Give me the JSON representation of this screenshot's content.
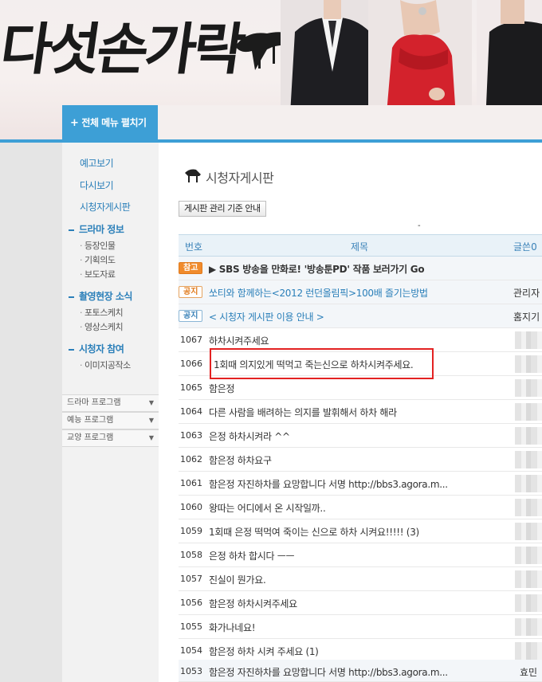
{
  "header": {
    "logo_text": "다섯손가락",
    "menu_button_plus": "+",
    "menu_button_label": "전체 메뉴 펼치기"
  },
  "sidebar": {
    "links": [
      "예고보기",
      "다시보기",
      "시청자게시판"
    ],
    "sections": [
      {
        "title": "드라마 정보",
        "items": [
          "등장인물",
          "기획의도",
          "보도자료"
        ]
      },
      {
        "title": "촬영현장 소식",
        "items": [
          "포토스케치",
          "영상스케치"
        ]
      },
      {
        "title": "시청자 참여",
        "items": [
          "이미지공작소"
        ]
      }
    ],
    "dropdowns": [
      "드라마 프로그램",
      "예능 프로그램",
      "교양 프로그램"
    ]
  },
  "board": {
    "title": "시청자게시판",
    "guide_button": "게시판 관리 기준 안내",
    "tick": "-",
    "columns": {
      "num": "번호",
      "title": "제목",
      "author": "글쓴0"
    },
    "pinned": [
      {
        "badge": "참고",
        "title": "▶ SBS 방송을 만화로! '방송툰PD' 작품 보러가기 Go",
        "author": ""
      },
      {
        "badge": "공지",
        "title": "쏘티와 함께하는<2012 런던올림픽>100배 즐기는방법",
        "author": "관리자"
      },
      {
        "badge": "공지",
        "title": "< 시청자 게시판 이용 안내 >",
        "author": "홈지기"
      }
    ],
    "posts": [
      {
        "num": "1067",
        "title": "하차시켜주세요"
      },
      {
        "num": "1066",
        "title": "1회때 의지있게 떡먹고 죽는신으로 하차시켜주세요."
      },
      {
        "num": "1065",
        "title": "함은정"
      },
      {
        "num": "1064",
        "title": "다른 사람을 배려하는 의지를 발휘해서 하차 해라"
      },
      {
        "num": "1063",
        "title": "은정 하차시켜라 ^^"
      },
      {
        "num": "1062",
        "title": "함은정 하차요구"
      },
      {
        "num": "1061",
        "title": "함은정 자진하차를 요망합니다 서명 http://bbs3.agora.m..."
      },
      {
        "num": "1060",
        "title": "왕따는 어디에서 온 시작일까.."
      },
      {
        "num": "1059",
        "title": "1회때 은정 떡먹여 죽이는 신으로 하차 시켜요!!!!! (3)"
      },
      {
        "num": "1058",
        "title": "은정 하차 합시다 ㅡㅡ"
      },
      {
        "num": "1057",
        "title": "진실이 뭔가요."
      },
      {
        "num": "1056",
        "title": "함은정 하차시켜주세요"
      },
      {
        "num": "1055",
        "title": "화가나네요!"
      },
      {
        "num": "1054",
        "title": "함은정 하차 시켜 주세요 (1)"
      },
      {
        "num": "1053",
        "title": "함은정 자진하차를 요망합니다 서명 http://bbs3.agora.m...",
        "author": "효민"
      }
    ]
  },
  "colors": {
    "accent": "#3d9fd6",
    "highlight": "#e32222",
    "badge_orange": "#f08b2c"
  }
}
